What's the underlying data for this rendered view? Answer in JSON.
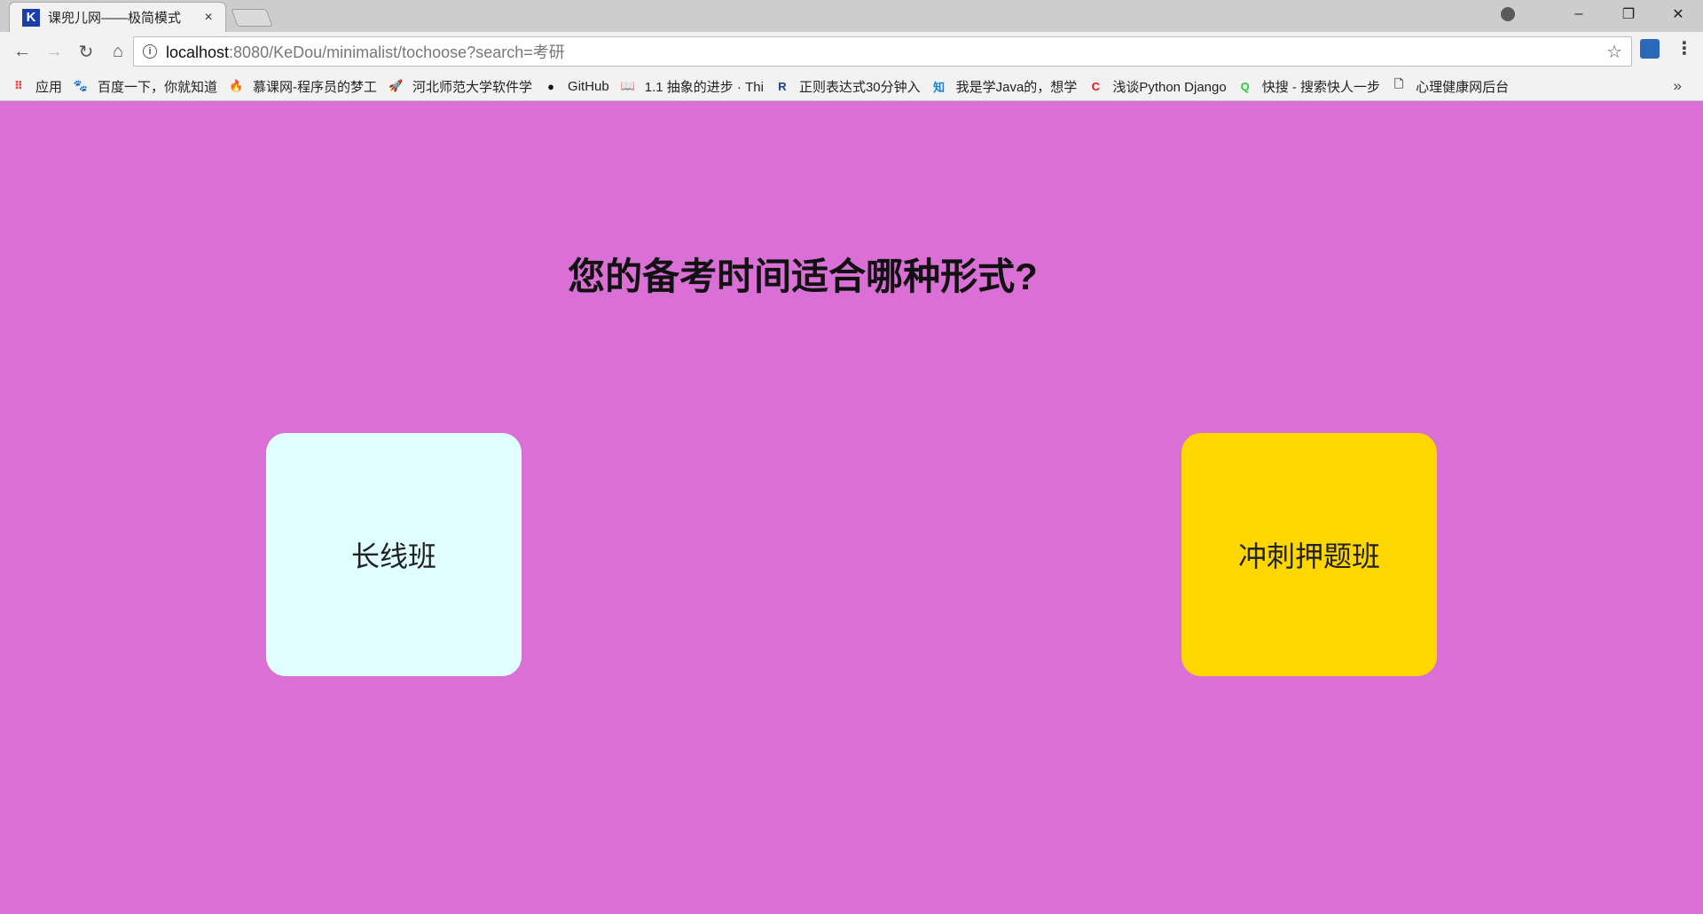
{
  "browser": {
    "tab": {
      "favicon": "K",
      "title": "课兜儿网——极简模式",
      "close": "×"
    },
    "window_controls": {
      "minimize": "–",
      "restore": "❐",
      "close": "✕"
    },
    "toolbar": {
      "back": "←",
      "forward": "→",
      "reload": "↻",
      "home": "⌂",
      "url_host": "localhost",
      "url_rest": ":8080/KeDou/minimalist/tochoose?search=考研",
      "star": "☆",
      "menu": "⋮"
    },
    "bookmarks": [
      {
        "label": "应用",
        "icon": "apps-grid-icon",
        "glyph": "⠿",
        "color": "#e8453c"
      },
      {
        "label": "百度一下，你就知道",
        "icon": "baidu-paw-icon",
        "glyph": "🐾",
        "color": "#3388ff"
      },
      {
        "label": "慕课网-程序员的梦工",
        "icon": "flame-icon",
        "glyph": "🔥",
        "color": "#f01414"
      },
      {
        "label": "河北师范大学软件学",
        "icon": "rocket-icon",
        "glyph": "🚀",
        "color": "#e85a2c"
      },
      {
        "label": "GitHub",
        "icon": "github-icon",
        "glyph": "●",
        "color": "#111111"
      },
      {
        "label": "1.1 抽象的进步 · Thi",
        "icon": "book-icon",
        "glyph": "📖",
        "color": "#333333"
      },
      {
        "label": "正则表达式30分钟入",
        "icon": "r-icon",
        "glyph": "R",
        "color": "#1a3fa8"
      },
      {
        "label": "我是学Java的，想学",
        "icon": "zhihu-icon",
        "glyph": "知",
        "color": "#0f88eb"
      },
      {
        "label": "浅谈Python Django",
        "icon": "csdn-icon",
        "glyph": "C",
        "color": "#e8141e"
      },
      {
        "label": "快搜 - 搜索快人一步",
        "icon": "kuaisou-icon",
        "glyph": "Q",
        "color": "#2ecc40"
      },
      {
        "label": "心理健康网后台",
        "icon": "page-icon",
        "glyph": "🗋",
        "color": "#555555"
      }
    ],
    "bookmarks_more": "»"
  },
  "page": {
    "question": "您的备考时间适合哪种形式?",
    "choices": {
      "long": "长线班",
      "sprint": "冲刺押题班"
    }
  },
  "colors": {
    "background": "#da70d6",
    "choice_long": "#e0ffff",
    "choice_sprint": "#ffd700"
  }
}
